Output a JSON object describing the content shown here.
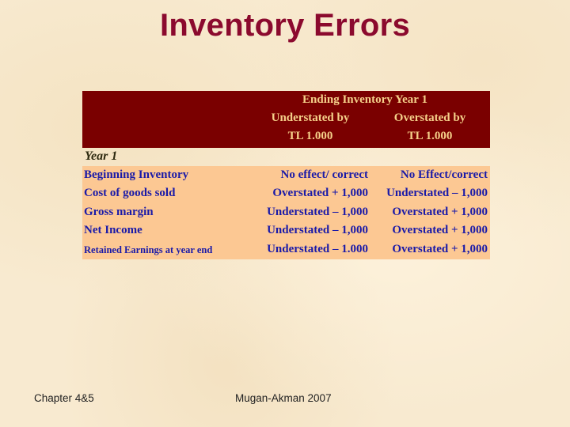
{
  "slide": {
    "title": "Inventory Errors",
    "colors": {
      "title": "#8b0a2e",
      "header_bg": "#7a0000",
      "header_text": "#f5d08a",
      "rows_bg": "#fcc893",
      "rows_text": "#1a1aa8",
      "background": "#f8ead0"
    }
  },
  "table": {
    "header": {
      "group_title": "Ending Inventory Year 1",
      "columns": [
        {
          "line1": "Understated by",
          "line2": "TL 1.000"
        },
        {
          "line1": "Overstated by",
          "line2": "TL 1.000"
        }
      ]
    },
    "section_label": "Year 1",
    "rows": [
      {
        "label": "Beginning Inventory",
        "understated": "No effect/ correct",
        "overstated": "No Effect/correct"
      },
      {
        "label": "Cost of goods sold",
        "understated": "Overstated + 1,000",
        "overstated": "Understated – 1,000"
      },
      {
        "label": "Gross margin",
        "understated": "Understated – 1,000",
        "overstated": "Overstated + 1,000"
      },
      {
        "label": "Net Income",
        "understated": "Understated – 1,000",
        "overstated": "Overstated + 1,000"
      },
      {
        "label": "Retained Earnings at year end",
        "understated": "Understated – 1.000",
        "overstated": "Overstated + 1,000"
      }
    ]
  },
  "footer": {
    "left": "Chapter 4&5",
    "center": "Mugan-Akman 2007"
  }
}
